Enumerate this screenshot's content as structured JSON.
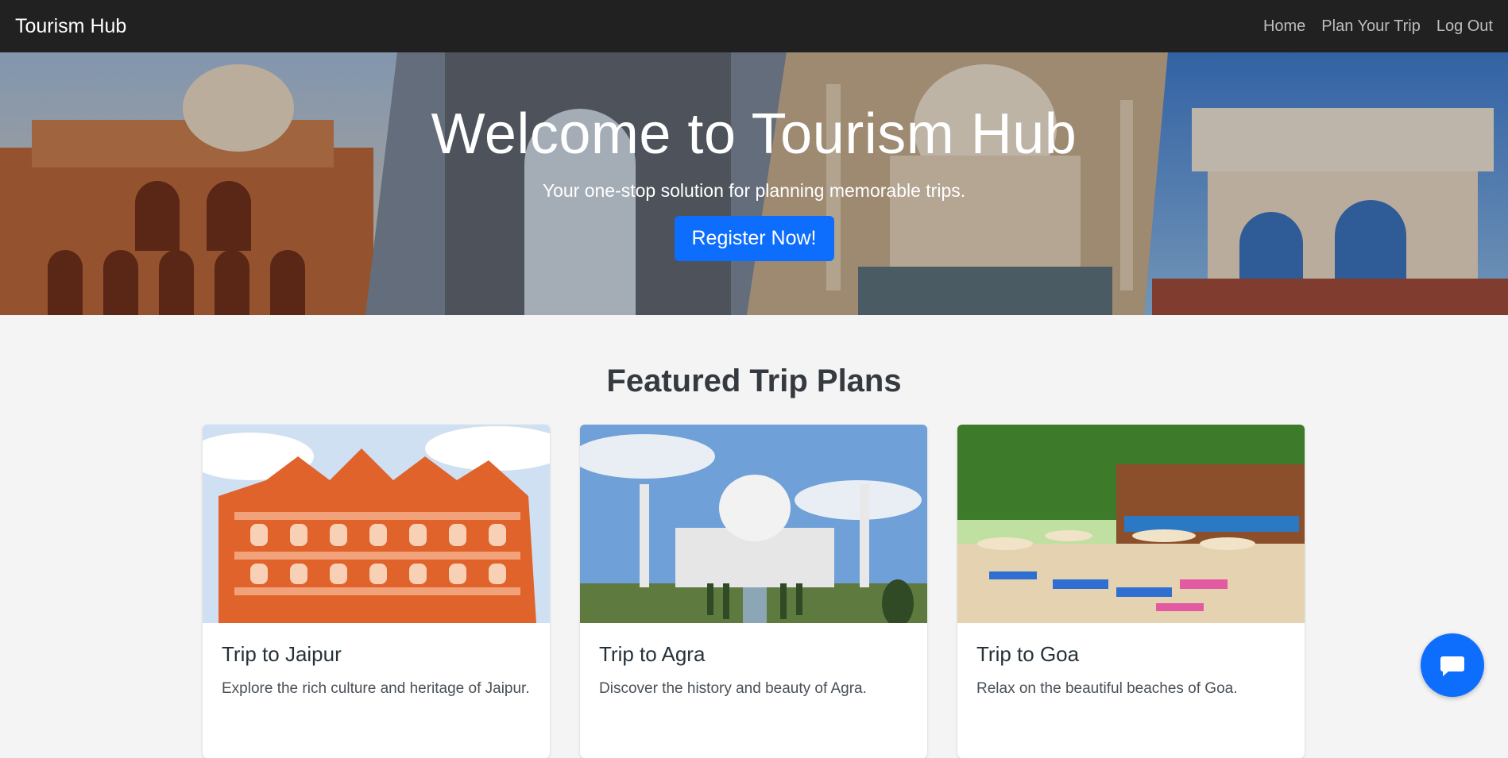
{
  "navbar": {
    "brand": "Tourism Hub",
    "links": [
      "Home",
      "Plan Your Trip",
      "Log Out"
    ]
  },
  "hero": {
    "title": "Welcome to Tourism Hub",
    "subtitle": "Your one-stop solution for planning memorable trips.",
    "cta_label": "Register Now!"
  },
  "featured": {
    "title": "Featured Trip Plans",
    "cards": [
      {
        "title": "Trip to Jaipur",
        "text": "Explore the rich culture and heritage of Jaipur."
      },
      {
        "title": "Trip to Agra",
        "text": "Discover the history and beauty of Agra."
      },
      {
        "title": "Trip to Goa",
        "text": "Relax on the beautiful beaches of Goa."
      }
    ]
  },
  "chat": {
    "icon": "chat-bubble-icon"
  },
  "colors": {
    "navbar": "#212121",
    "primary": "#0d6efd",
    "background": "#f4f4f4"
  }
}
